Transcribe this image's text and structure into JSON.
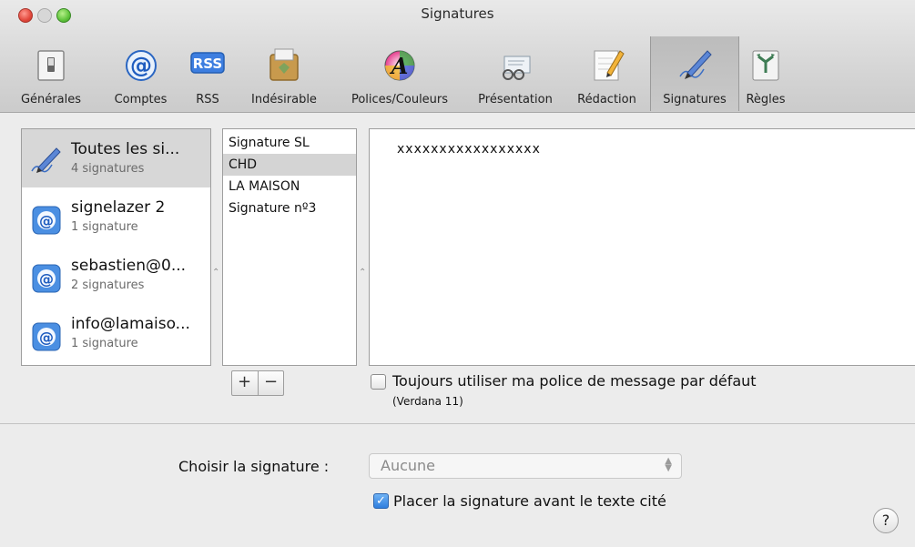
{
  "window": {
    "title": "Signatures"
  },
  "toolbar": {
    "items": [
      {
        "label": "Générales",
        "icon": "general-switch-icon"
      },
      {
        "label": "Comptes",
        "icon": "at-sign-icon"
      },
      {
        "label": "RSS",
        "icon": "rss-icon"
      },
      {
        "label": "Indésirable",
        "icon": "junk-mail-icon"
      },
      {
        "label": "Polices/Couleurs",
        "icon": "fonts-colors-icon"
      },
      {
        "label": "Présentation",
        "icon": "viewing-glasses-icon"
      },
      {
        "label": "Rédaction",
        "icon": "composing-pencil-icon"
      },
      {
        "label": "Signatures",
        "icon": "signature-pen-icon",
        "selected": true
      },
      {
        "label": "Règles",
        "icon": "rules-icon"
      }
    ]
  },
  "accounts": [
    {
      "name": "Toutes les si...",
      "count": "4 signatures",
      "icon": "signature-pen-icon",
      "selected": true
    },
    {
      "name": "signelazer 2",
      "count": "1 signature",
      "icon": "mail-account-icon"
    },
    {
      "name": "sebastien@0...",
      "count": "2 signatures",
      "icon": "mail-account-icon"
    },
    {
      "name": "info@lamaiso...",
      "count": "1 signature",
      "icon": "mail-account-icon"
    }
  ],
  "signatures": [
    {
      "name": "Signature SL"
    },
    {
      "name": "CHD",
      "selected": true
    },
    {
      "name": "LA MAISON"
    },
    {
      "name": "Signature nº3"
    }
  ],
  "editor": {
    "content": "xxxxxxxxxxxxxxxxx"
  },
  "buttons": {
    "add": "+",
    "remove": "−"
  },
  "font_option": {
    "label": "Toujours utiliser ma police de message par défaut",
    "note": "(Verdana 11)",
    "checked": false
  },
  "choose": {
    "label": "Choisir la signature :",
    "value": "Aucune"
  },
  "place_before": {
    "label": "Placer la signature avant le texte cité",
    "checked": true
  },
  "help": {
    "label": "?"
  }
}
